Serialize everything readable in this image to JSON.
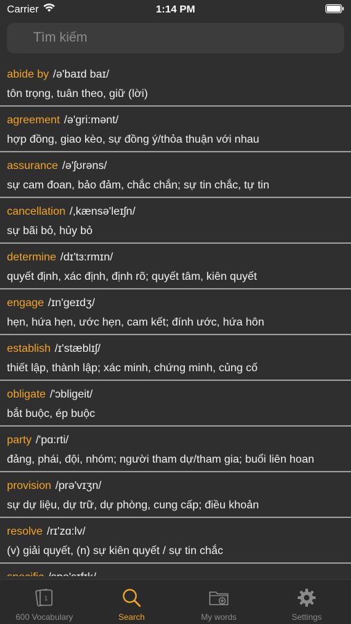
{
  "status_bar": {
    "carrier": "Carrier",
    "time": "1:14 PM",
    "wifi_icon": "wifi-icon",
    "battery_icon": "battery-icon"
  },
  "search": {
    "placeholder": "Tìm kiếm",
    "icon": "search-icon"
  },
  "colors": {
    "background": "#2f2f2f",
    "accent": "#f5a623",
    "divider": "#9a9a9a",
    "search_bg": "#3c3c3c"
  },
  "words": [
    {
      "word": "abide by",
      "ipa": "/ə'baɪd baɪ/",
      "meaning": "tôn trọng, tuân theo, giữ (lời)"
    },
    {
      "word": "agreement",
      "ipa": "/ə'gri:mənt/",
      "meaning": "hợp đồng, giao kèo, sự đồng ý/thỏa thuận với nhau"
    },
    {
      "word": "assurance",
      "ipa": "/ə'ʃʊrəns/",
      "meaning": "sự cam đoan, bảo đảm, chắc chắn; sự tin chắc, tự tin"
    },
    {
      "word": "cancellation",
      "ipa": "/,kænsə'leɪʃn/",
      "meaning": "sự bãi bỏ, hủy bỏ"
    },
    {
      "word": "determine",
      "ipa": "/dɪ'tɜ:rmɪn/",
      "meaning": "quyết định, xác định, định rõ; quyết tâm, kiên quyết"
    },
    {
      "word": "engage",
      "ipa": "/ɪn'geɪdʒ/",
      "meaning": "hẹn, hứa hẹn, ước hẹn, cam kết; đính ước, hứa hôn"
    },
    {
      "word": "establish",
      "ipa": "/ɪ'stæblɪʃ/",
      "meaning": "thiết lập, thành lập; xác minh, chứng minh, củng cố"
    },
    {
      "word": "obligate",
      "ipa": "/'ɔbligeit/",
      "meaning": "bắt buộc, ép buộc"
    },
    {
      "word": "party",
      "ipa": "/'pɑ:rti/",
      "meaning": "đảng, phái, đội, nhóm; người tham dự/tham gia; buổi liên hoan"
    },
    {
      "word": "provision",
      "ipa": "/prə'vɪʒn/",
      "meaning": "sự dự liệu, dự trữ, dự phòng, cung cấp; điều khoản"
    },
    {
      "word": "resolve",
      "ipa": "/rɪ'zɑ:lv/",
      "meaning": "(v) giải quyết, (n) sự kiên quyết / sự tin chắc"
    },
    {
      "word": "specific",
      "ipa": "/spə'sɪfɪk/",
      "meaning": ""
    }
  ],
  "tabs": [
    {
      "label": "600 Vocabulary",
      "icon": "flashcards-icon",
      "active": false
    },
    {
      "label": "Search",
      "icon": "search-icon",
      "active": true
    },
    {
      "label": "My words",
      "icon": "folder-add-icon",
      "active": false
    },
    {
      "label": "Settings",
      "icon": "gear-icon",
      "active": false
    }
  ]
}
